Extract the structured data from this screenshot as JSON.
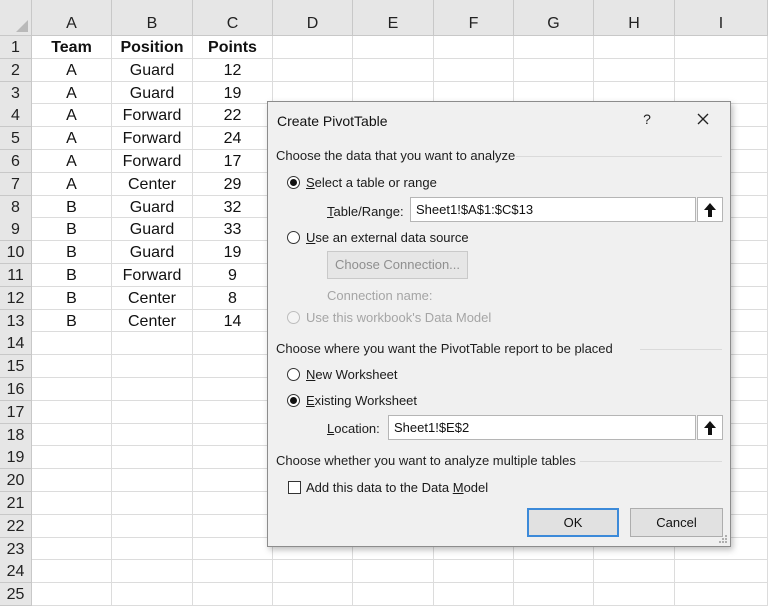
{
  "spreadsheet": {
    "column_headers": [
      "A",
      "B",
      "C",
      "D",
      "E",
      "F",
      "G",
      "H",
      "I"
    ],
    "row_headers": [
      "1",
      "2",
      "3",
      "4",
      "5",
      "6",
      "7",
      "8",
      "9",
      "10",
      "11",
      "12",
      "13",
      "14",
      "15",
      "16",
      "17",
      "18",
      "19",
      "20",
      "21",
      "22",
      "23",
      "24",
      "25"
    ],
    "header_row": [
      "Team",
      "Position",
      "Points"
    ],
    "rows": [
      [
        "A",
        "Guard",
        "12"
      ],
      [
        "A",
        "Guard",
        "19"
      ],
      [
        "A",
        "Forward",
        "22"
      ],
      [
        "A",
        "Forward",
        "24"
      ],
      [
        "A",
        "Forward",
        "17"
      ],
      [
        "A",
        "Center",
        "29"
      ],
      [
        "B",
        "Guard",
        "32"
      ],
      [
        "B",
        "Guard",
        "33"
      ],
      [
        "B",
        "Guard",
        "19"
      ],
      [
        "B",
        "Forward",
        "9"
      ],
      [
        "B",
        "Center",
        "8"
      ],
      [
        "B",
        "Center",
        "14"
      ]
    ]
  },
  "dialog": {
    "title": "Create PivotTable",
    "help_label": "?",
    "section_analyze": "Choose the data that you want to analyze",
    "opt_select_table_pre": "",
    "opt_select_table_acc": "S",
    "opt_select_table_post": "elect a table or range",
    "table_range_label_acc": "T",
    "table_range_label_post": "able/Range:",
    "table_range_value": "Sheet1!$A$1:$C$13",
    "opt_external_acc": "U",
    "opt_external_post": "se an external data source",
    "choose_connection_label": "Choose Connection...",
    "connection_name_label": "Connection name:",
    "opt_data_model": "Use this workbook's Data Model",
    "section_place": "Choose where you want the PivotTable report to be placed",
    "opt_new_ws_acc": "N",
    "opt_new_ws_post": "ew Worksheet",
    "opt_existing_ws_acc": "E",
    "opt_existing_ws_post": "xisting Worksheet",
    "location_label_acc": "L",
    "location_label_post": "ocation:",
    "location_value": "Sheet1!$E$2",
    "section_multiple": "Choose whether you want to analyze multiple tables",
    "add_data_model_pre": "Add this data to the Data ",
    "add_data_model_acc": "M",
    "add_data_model_post": "odel",
    "ok_label": "OK",
    "cancel_label": "Cancel"
  },
  "icons": {
    "close": "close-icon",
    "range_collapse": "up-arrow-icon",
    "resize": "resize-grip-icon"
  },
  "colors": {
    "header_bg": "#e6e6e6",
    "dialog_bg": "#f0f0f0",
    "default_button_border": "#3c8ad9"
  }
}
